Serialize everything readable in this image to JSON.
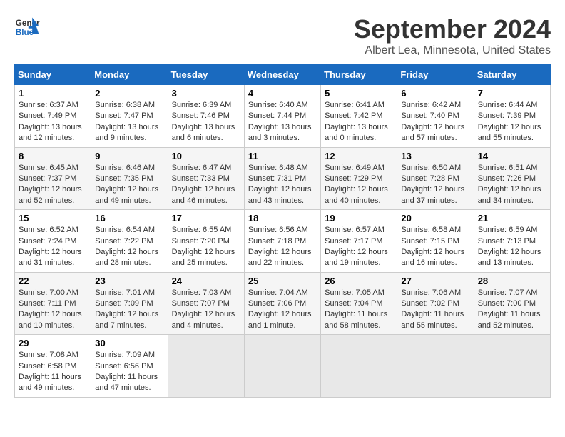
{
  "header": {
    "logo_general": "General",
    "logo_blue": "Blue",
    "month": "September 2024",
    "location": "Albert Lea, Minnesota, United States"
  },
  "days_of_week": [
    "Sunday",
    "Monday",
    "Tuesday",
    "Wednesday",
    "Thursday",
    "Friday",
    "Saturday"
  ],
  "weeks": [
    [
      {
        "day": "1",
        "info": "Sunrise: 6:37 AM\nSunset: 7:49 PM\nDaylight: 13 hours and 12 minutes."
      },
      {
        "day": "2",
        "info": "Sunrise: 6:38 AM\nSunset: 7:47 PM\nDaylight: 13 hours and 9 minutes."
      },
      {
        "day": "3",
        "info": "Sunrise: 6:39 AM\nSunset: 7:46 PM\nDaylight: 13 hours and 6 minutes."
      },
      {
        "day": "4",
        "info": "Sunrise: 6:40 AM\nSunset: 7:44 PM\nDaylight: 13 hours and 3 minutes."
      },
      {
        "day": "5",
        "info": "Sunrise: 6:41 AM\nSunset: 7:42 PM\nDaylight: 13 hours and 0 minutes."
      },
      {
        "day": "6",
        "info": "Sunrise: 6:42 AM\nSunset: 7:40 PM\nDaylight: 12 hours and 57 minutes."
      },
      {
        "day": "7",
        "info": "Sunrise: 6:44 AM\nSunset: 7:39 PM\nDaylight: 12 hours and 55 minutes."
      }
    ],
    [
      {
        "day": "8",
        "info": "Sunrise: 6:45 AM\nSunset: 7:37 PM\nDaylight: 12 hours and 52 minutes."
      },
      {
        "day": "9",
        "info": "Sunrise: 6:46 AM\nSunset: 7:35 PM\nDaylight: 12 hours and 49 minutes."
      },
      {
        "day": "10",
        "info": "Sunrise: 6:47 AM\nSunset: 7:33 PM\nDaylight: 12 hours and 46 minutes."
      },
      {
        "day": "11",
        "info": "Sunrise: 6:48 AM\nSunset: 7:31 PM\nDaylight: 12 hours and 43 minutes."
      },
      {
        "day": "12",
        "info": "Sunrise: 6:49 AM\nSunset: 7:29 PM\nDaylight: 12 hours and 40 minutes."
      },
      {
        "day": "13",
        "info": "Sunrise: 6:50 AM\nSunset: 7:28 PM\nDaylight: 12 hours and 37 minutes."
      },
      {
        "day": "14",
        "info": "Sunrise: 6:51 AM\nSunset: 7:26 PM\nDaylight: 12 hours and 34 minutes."
      }
    ],
    [
      {
        "day": "15",
        "info": "Sunrise: 6:52 AM\nSunset: 7:24 PM\nDaylight: 12 hours and 31 minutes."
      },
      {
        "day": "16",
        "info": "Sunrise: 6:54 AM\nSunset: 7:22 PM\nDaylight: 12 hours and 28 minutes."
      },
      {
        "day": "17",
        "info": "Sunrise: 6:55 AM\nSunset: 7:20 PM\nDaylight: 12 hours and 25 minutes."
      },
      {
        "day": "18",
        "info": "Sunrise: 6:56 AM\nSunset: 7:18 PM\nDaylight: 12 hours and 22 minutes."
      },
      {
        "day": "19",
        "info": "Sunrise: 6:57 AM\nSunset: 7:17 PM\nDaylight: 12 hours and 19 minutes."
      },
      {
        "day": "20",
        "info": "Sunrise: 6:58 AM\nSunset: 7:15 PM\nDaylight: 12 hours and 16 minutes."
      },
      {
        "day": "21",
        "info": "Sunrise: 6:59 AM\nSunset: 7:13 PM\nDaylight: 12 hours and 13 minutes."
      }
    ],
    [
      {
        "day": "22",
        "info": "Sunrise: 7:00 AM\nSunset: 7:11 PM\nDaylight: 12 hours and 10 minutes."
      },
      {
        "day": "23",
        "info": "Sunrise: 7:01 AM\nSunset: 7:09 PM\nDaylight: 12 hours and 7 minutes."
      },
      {
        "day": "24",
        "info": "Sunrise: 7:03 AM\nSunset: 7:07 PM\nDaylight: 12 hours and 4 minutes."
      },
      {
        "day": "25",
        "info": "Sunrise: 7:04 AM\nSunset: 7:06 PM\nDaylight: 12 hours and 1 minute."
      },
      {
        "day": "26",
        "info": "Sunrise: 7:05 AM\nSunset: 7:04 PM\nDaylight: 11 hours and 58 minutes."
      },
      {
        "day": "27",
        "info": "Sunrise: 7:06 AM\nSunset: 7:02 PM\nDaylight: 11 hours and 55 minutes."
      },
      {
        "day": "28",
        "info": "Sunrise: 7:07 AM\nSunset: 7:00 PM\nDaylight: 11 hours and 52 minutes."
      }
    ],
    [
      {
        "day": "29",
        "info": "Sunrise: 7:08 AM\nSunset: 6:58 PM\nDaylight: 11 hours and 49 minutes."
      },
      {
        "day": "30",
        "info": "Sunrise: 7:09 AM\nSunset: 6:56 PM\nDaylight: 11 hours and 47 minutes."
      },
      {
        "day": "",
        "info": ""
      },
      {
        "day": "",
        "info": ""
      },
      {
        "day": "",
        "info": ""
      },
      {
        "day": "",
        "info": ""
      },
      {
        "day": "",
        "info": ""
      }
    ]
  ]
}
